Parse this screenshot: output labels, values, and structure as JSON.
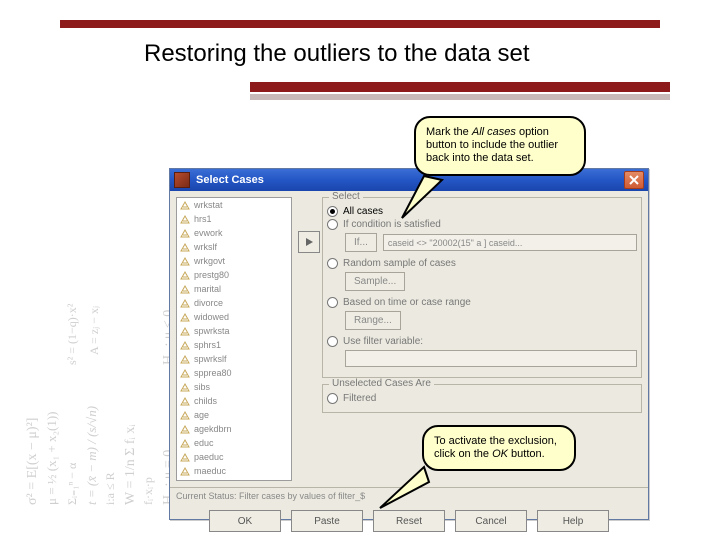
{
  "slide": {
    "title": "Restoring the outliers to the data set"
  },
  "dialog": {
    "title": "Select Cases",
    "variables": [
      "wrkstat",
      "hrs1",
      "evwork",
      "wrkslf",
      "wrkgovt",
      "prestg80",
      "marital",
      "divorce",
      "widowed",
      "spwrksta",
      "sphrs1",
      "spwrkslf",
      "spprea80",
      "sibs",
      "childs",
      "age",
      "agekdbrn",
      "educ",
      "paeduc",
      "maeduc"
    ],
    "select_group": {
      "title": "Select",
      "opt_all": "All cases",
      "opt_cond": "If condition is satisfied",
      "cond_btn": "If...",
      "cond_text": "caseid <> \"20002(15\" a ] caseid...",
      "opt_random": "Random sample of cases",
      "random_btn": "Sample...",
      "opt_range": "Based on time or case range",
      "range_btn": "Range...",
      "opt_filter": "Use filter variable:"
    },
    "unsel_group": {
      "title": "Unselected Cases Are",
      "opt_filtered": "Filtered"
    },
    "status_line": "Current Status:  Filter cases by values of filter_$",
    "buttons": {
      "ok": "OK",
      "paste": "Paste",
      "reset": "Reset",
      "cancel": "Cancel",
      "help": "Help"
    }
  },
  "callouts": {
    "c1_a": "Mark the ",
    "c1_em": "All cases",
    "c1_b": " option button to include the outlier back into the data set.",
    "c2_a": "To activate the exclusion, click on the ",
    "c2_em": "OK",
    "c2_b": " button."
  }
}
